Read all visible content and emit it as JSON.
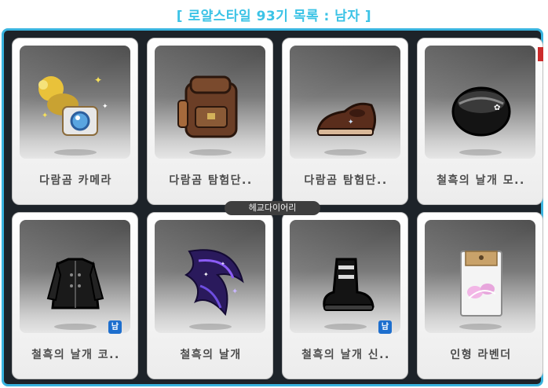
{
  "header": {
    "title": "[ 로얄스타일 93기 목록 : 남자 ]"
  },
  "watermark": "헤교다이어리",
  "items": [
    {
      "name": "다람곰 카메라",
      "icon": "squirrel-camera-icon",
      "badge": ""
    },
    {
      "name": "다람곰 탐험단..",
      "icon": "backpack-icon",
      "badge": ""
    },
    {
      "name": "다람곰 탐험단..",
      "icon": "shoes-icon",
      "badge": ""
    },
    {
      "name": "철흑의 날개 모..",
      "icon": "hat-icon",
      "badge": ""
    },
    {
      "name": "철흑의 날개 코..",
      "icon": "coat-icon",
      "badge": "남"
    },
    {
      "name": "철흑의 날개",
      "icon": "wing-effect-icon",
      "badge": ""
    },
    {
      "name": "철흑의 날개 신..",
      "icon": "boots-icon",
      "badge": "남"
    },
    {
      "name": "인형 라벤더",
      "icon": "doll-package-icon",
      "badge": ""
    }
  ],
  "colors": {
    "accent": "#39b3de",
    "frame_bg": "#1d2329",
    "badge": "#1e6fce"
  }
}
